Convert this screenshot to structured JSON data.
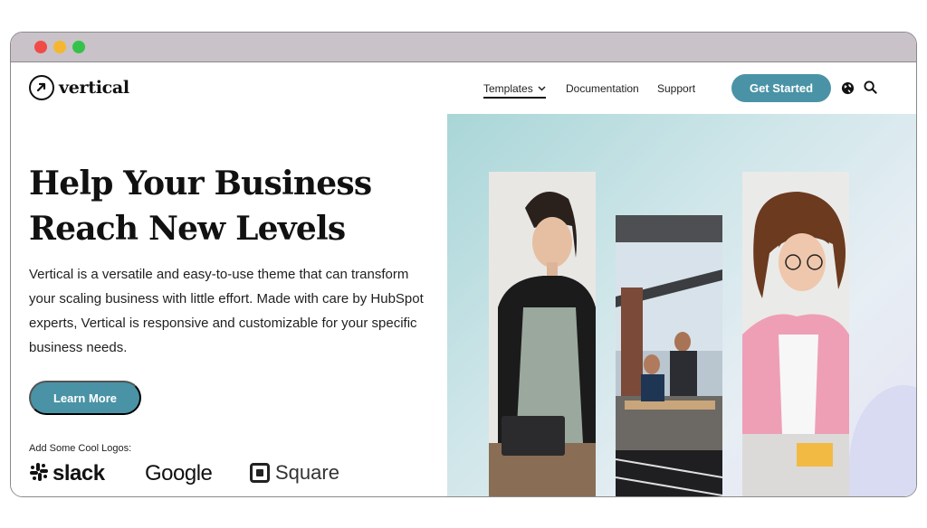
{
  "brand": {
    "name": "vertical"
  },
  "nav": {
    "templates": "Templates",
    "documentation": "Documentation",
    "support": "Support"
  },
  "header": {
    "cta": "Get Started"
  },
  "hero": {
    "title_line1": "Help Your Business",
    "title_line2": "Reach New Levels",
    "body": "Vertical is a versatile and easy-to-use theme that can transform your scaling business with little effort. Made with care by HubSpot experts, Vertical is responsive and customizable for your specific business needs.",
    "cta": "Learn More"
  },
  "logos": {
    "label": "Add Some Cool Logos:",
    "items": [
      "slack",
      "Google",
      "Square"
    ]
  },
  "colors": {
    "accent": "#4a93a6",
    "titlebar": "#c9c2c8"
  }
}
